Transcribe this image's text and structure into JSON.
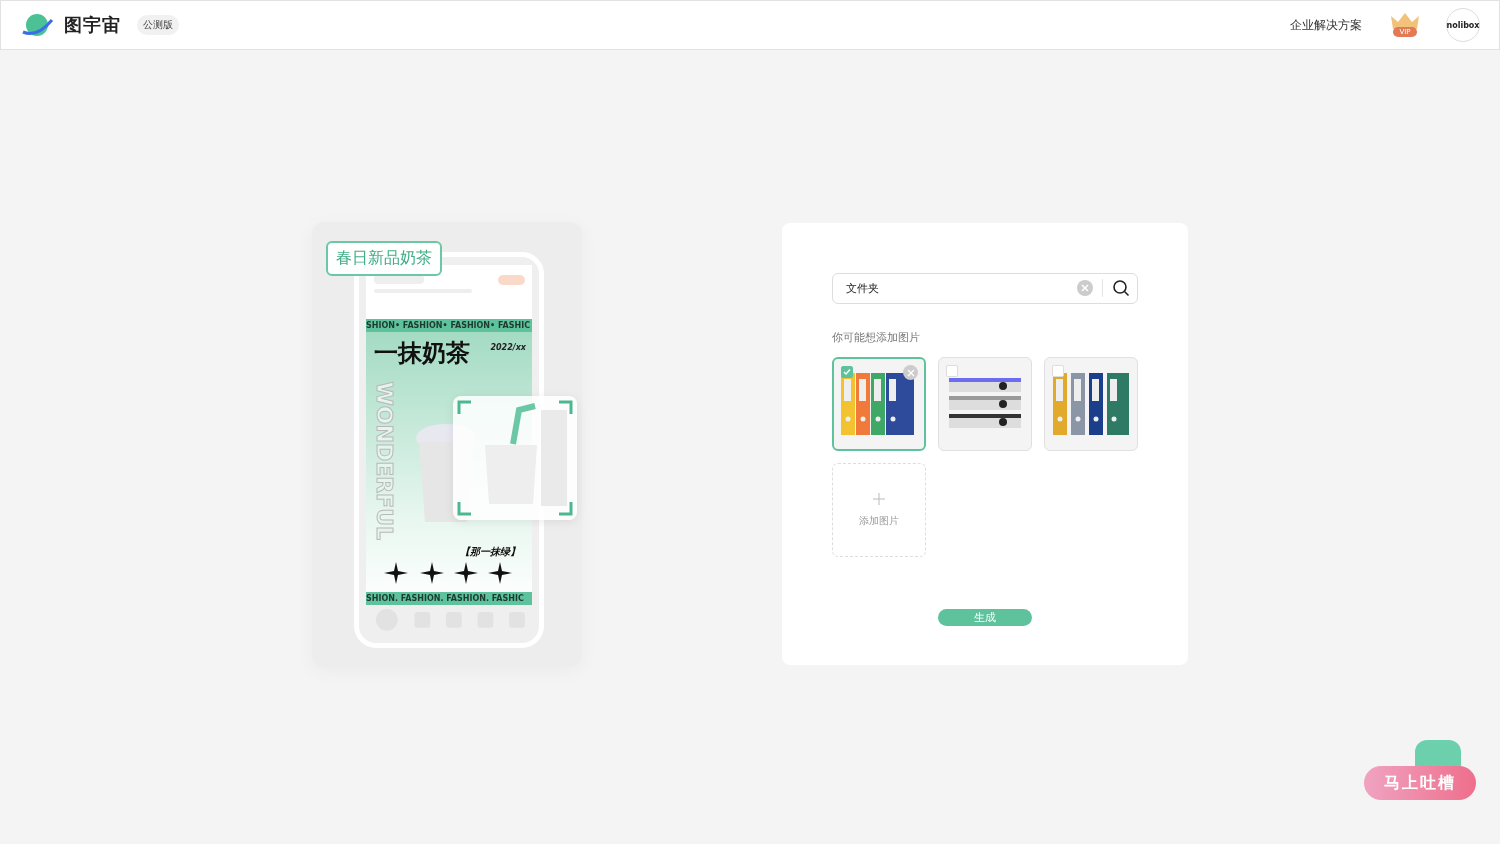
{
  "header": {
    "logo": "图宇宙",
    "badge": "公测版",
    "link": "企业解决方案",
    "vip": "VIP",
    "avatar": "nolibox"
  },
  "illustration": {
    "tag": "春日新品奶茶",
    "ticker_top": "SHION• FASHION• FASHION• FASHIC",
    "title": "一抹奶茶",
    "date": "2022/xx",
    "vertical": "WONDERFUL",
    "slogan": "【那一抹绿】",
    "ticker_bottom": "SHION. FASHION. FASHION. FASHIC"
  },
  "panel": {
    "search": {
      "value": "文件夹"
    },
    "hint": "你可能想添加图片",
    "images": [
      {
        "selected": true,
        "checked": true
      },
      {
        "selected": false,
        "checked": false
      },
      {
        "selected": false,
        "checked": false
      }
    ],
    "add_label": "添加图片",
    "generate": "生成"
  },
  "feedback": {
    "label": "马上吐槽"
  }
}
